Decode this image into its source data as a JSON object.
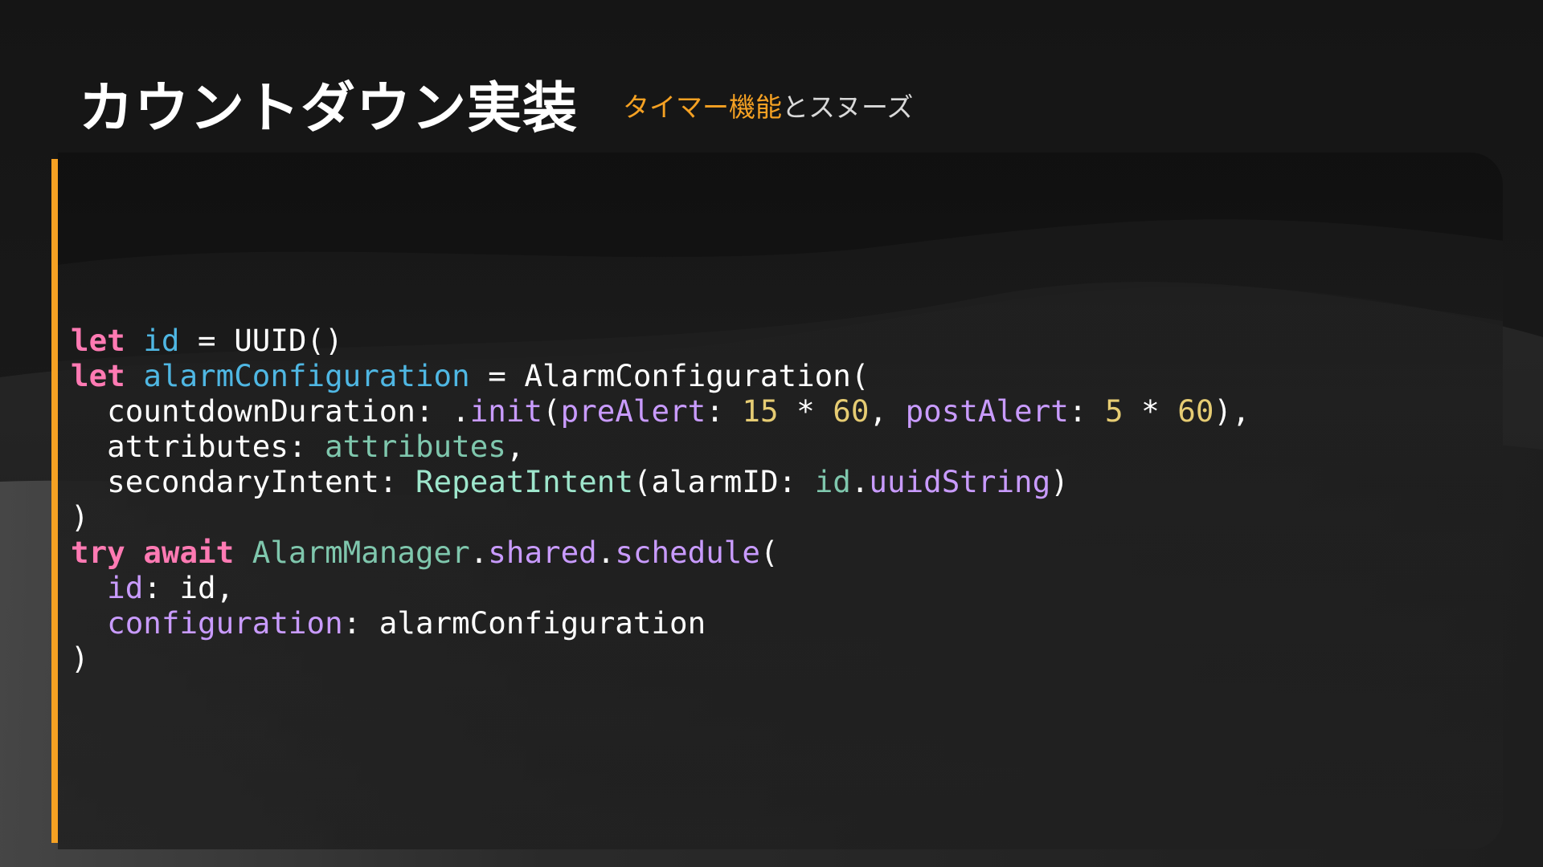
{
  "slide": {
    "title": "カウントダウン実装",
    "subtitle_parts": [
      {
        "text": "タイマー機能",
        "color": "#f5a123"
      },
      {
        "text": "とスヌーズ",
        "color": "#d9d9d9"
      }
    ]
  },
  "colors": {
    "accent": "#f5a123",
    "keyword": "#ff7ab3",
    "variable": "#4fb7e3",
    "plain": "#ffffff",
    "type": "#9ee6cc",
    "type_muted": "#7fc7ad",
    "member": "#c99bff",
    "number": "#e6cc73"
  },
  "code": {
    "language": "swift",
    "lines": [
      [
        {
          "t": "let",
          "c": "keyword",
          "b": true
        },
        {
          "t": " "
        },
        {
          "t": "id",
          "c": "variable"
        },
        {
          "t": " = UUID()"
        }
      ],
      [
        {
          "t": "let",
          "c": "keyword",
          "b": true
        },
        {
          "t": " "
        },
        {
          "t": "alarmConfiguration",
          "c": "variable"
        },
        {
          "t": " = AlarmConfiguration("
        }
      ],
      [
        {
          "t": "  countdownDuration: ."
        },
        {
          "t": "init",
          "c": "member"
        },
        {
          "t": "("
        },
        {
          "t": "preAlert",
          "c": "member"
        },
        {
          "t": ": "
        },
        {
          "t": "15",
          "c": "number"
        },
        {
          "t": " * "
        },
        {
          "t": "60",
          "c": "number"
        },
        {
          "t": ", "
        },
        {
          "t": "postAlert",
          "c": "member"
        },
        {
          "t": ": "
        },
        {
          "t": "5",
          "c": "number"
        },
        {
          "t": " * "
        },
        {
          "t": "60",
          "c": "number"
        },
        {
          "t": "),"
        }
      ],
      [
        {
          "t": "  attributes: "
        },
        {
          "t": "attributes",
          "c": "type_muted"
        },
        {
          "t": ","
        }
      ],
      [
        {
          "t": "  secondaryIntent: "
        },
        {
          "t": "RepeatIntent",
          "c": "type"
        },
        {
          "t": "(alarmID: "
        },
        {
          "t": "id",
          "c": "type_muted"
        },
        {
          "t": "."
        },
        {
          "t": "uuidString",
          "c": "member"
        },
        {
          "t": ")"
        }
      ],
      [
        {
          "t": ")"
        }
      ],
      [
        {
          "t": "try",
          "c": "keyword",
          "b": true
        },
        {
          "t": " "
        },
        {
          "t": "await",
          "c": "keyword",
          "b": true
        },
        {
          "t": " "
        },
        {
          "t": "AlarmManager",
          "c": "type_muted"
        },
        {
          "t": "."
        },
        {
          "t": "shared",
          "c": "member"
        },
        {
          "t": "."
        },
        {
          "t": "schedule",
          "c": "member"
        },
        {
          "t": "("
        }
      ],
      [
        {
          "t": "  "
        },
        {
          "t": "id",
          "c": "member"
        },
        {
          "t": ": id,"
        }
      ],
      [
        {
          "t": "  "
        },
        {
          "t": "configuration",
          "c": "member"
        },
        {
          "t": ": alarmConfiguration"
        }
      ],
      [
        {
          "t": ")"
        }
      ]
    ]
  }
}
